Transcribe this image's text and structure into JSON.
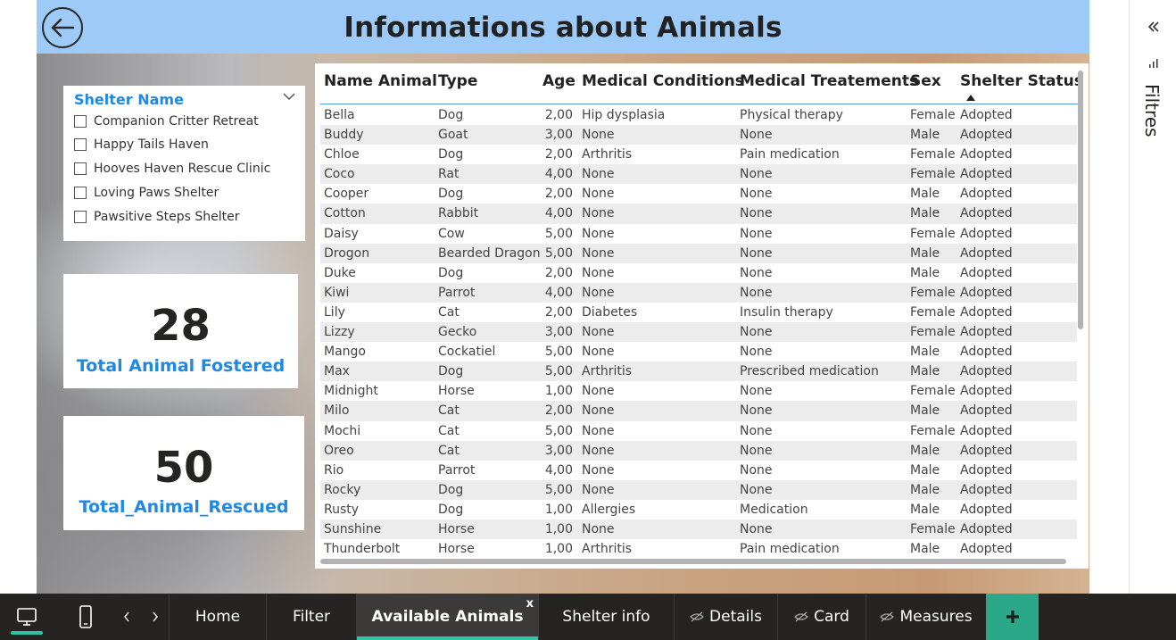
{
  "header": {
    "title": "Informations about Animals"
  },
  "slicer": {
    "title": "Shelter Name",
    "items": [
      {
        "label": "Companion Critter Retreat",
        "checked": false
      },
      {
        "label": "Happy Tails Haven",
        "checked": false
      },
      {
        "label": "Hooves Haven Rescue Clinic",
        "checked": false
      },
      {
        "label": "Loving Paws Shelter",
        "checked": false
      },
      {
        "label": "Pawsitive Steps Shelter",
        "checked": false
      }
    ]
  },
  "cards": {
    "fostered": {
      "value": "28",
      "label": "Total Animal Fostered"
    },
    "rescued": {
      "value": "50",
      "label": "Total_Animal_Rescued"
    }
  },
  "table": {
    "columns": [
      "Name Animal",
      "Type",
      "Age",
      "Medical Conditions",
      "Medical Treatements",
      "Sex",
      "Shelter Status"
    ],
    "sorted_by": "Shelter Status",
    "rows": [
      [
        "Bella",
        "Dog",
        "2,00",
        "Hip dysplasia",
        "Physical therapy",
        "Female",
        "Adopted"
      ],
      [
        "Buddy",
        "Goat",
        "3,00",
        "None",
        "None",
        "Male",
        "Adopted"
      ],
      [
        "Chloe",
        "Dog",
        "2,00",
        "Arthritis",
        "Pain medication",
        "Female",
        "Adopted"
      ],
      [
        "Coco",
        "Rat",
        "4,00",
        "None",
        "None",
        "Female",
        "Adopted"
      ],
      [
        "Cooper",
        "Dog",
        "2,00",
        "None",
        "None",
        "Male",
        "Adopted"
      ],
      [
        "Cotton",
        "Rabbit",
        "4,00",
        "None",
        "None",
        "Male",
        "Adopted"
      ],
      [
        "Daisy",
        "Cow",
        "5,00",
        "None",
        "None",
        "Female",
        "Adopted"
      ],
      [
        "Drogon",
        "Bearded Dragon",
        "5,00",
        "None",
        "None",
        "Male",
        "Adopted"
      ],
      [
        "Duke",
        "Dog",
        "2,00",
        "None",
        "None",
        "Male",
        "Adopted"
      ],
      [
        "Kiwi",
        "Parrot",
        "4,00",
        "None",
        "None",
        "Female",
        "Adopted"
      ],
      [
        "Lily",
        "Cat",
        "2,00",
        "Diabetes",
        "Insulin therapy",
        "Female",
        "Adopted"
      ],
      [
        "Lizzy",
        "Gecko",
        "3,00",
        "None",
        "None",
        "Female",
        "Adopted"
      ],
      [
        "Mango",
        "Cockatiel",
        "5,00",
        "None",
        "None",
        "Male",
        "Adopted"
      ],
      [
        "Max",
        "Dog",
        "5,00",
        "Arthritis",
        "Prescribed medication",
        "Male",
        "Adopted"
      ],
      [
        "Midnight",
        "Horse",
        "1,00",
        "None",
        "None",
        "Female",
        "Adopted"
      ],
      [
        "Milo",
        "Cat",
        "2,00",
        "None",
        "None",
        "Male",
        "Adopted"
      ],
      [
        "Mochi",
        "Cat",
        "5,00",
        "None",
        "None",
        "Female",
        "Adopted"
      ],
      [
        "Oreo",
        "Cat",
        "3,00",
        "None",
        "None",
        "Male",
        "Adopted"
      ],
      [
        "Rio",
        "Parrot",
        "4,00",
        "None",
        "None",
        "Male",
        "Adopted"
      ],
      [
        "Rocky",
        "Dog",
        "5,00",
        "None",
        "None",
        "Male",
        "Adopted"
      ],
      [
        "Rusty",
        "Dog",
        "1,00",
        "Allergies",
        "Medication",
        "Male",
        "Adopted"
      ],
      [
        "Sunshine",
        "Horse",
        "1,00",
        "None",
        "None",
        "Female",
        "Adopted"
      ],
      [
        "Thunderbolt",
        "Horse",
        "1,00",
        "Arthritis",
        "Pain medication",
        "Male",
        "Adopted"
      ]
    ]
  },
  "filters_pane": {
    "label": "Filtres"
  },
  "bottom_nav": {
    "tabs": [
      {
        "label": "Home",
        "hidden": false,
        "active": false
      },
      {
        "label": "Filter",
        "hidden": false,
        "active": false
      },
      {
        "label": "Available Animals",
        "hidden": false,
        "active": true
      },
      {
        "label": "Shelter info",
        "hidden": false,
        "active": false
      },
      {
        "label": "Details",
        "hidden": true,
        "active": false
      },
      {
        "label": "Card",
        "hidden": true,
        "active": false
      },
      {
        "label": "Measures",
        "hidden": true,
        "active": false
      }
    ],
    "close_label": "x",
    "add_label": "+"
  },
  "colors": {
    "header_bg": "#9dcaf7",
    "accent_blue": "#1e88e5",
    "nav_bg": "#252423",
    "nav_accent": "#2ec4a5",
    "add_button": "#2aa888"
  }
}
